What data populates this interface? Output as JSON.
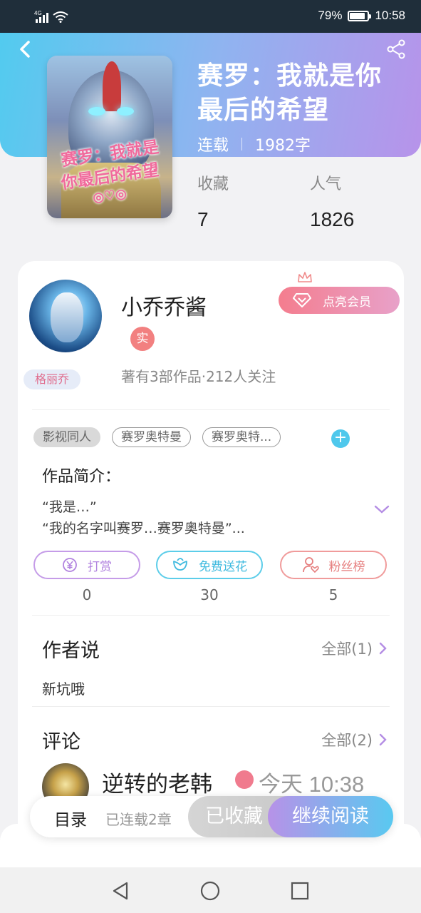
{
  "status_bar": {
    "network": "4G",
    "battery_percent_text": "79%",
    "battery_level": 0.79,
    "time": "10:58"
  },
  "header": {
    "back_icon": "chevron-left-icon",
    "share_icon": "share-icon",
    "cover_text_line1": "赛罗：我就是",
    "cover_text_line2": "你最后的希望",
    "cover_text_line3": "◎♡◎",
    "title": "赛罗：我就是你最后的希望",
    "status": "连载",
    "word_count": "1982字"
  },
  "stats": {
    "favorites_label": "收藏",
    "favorites_value": "7",
    "popularity_label": "人气",
    "popularity_value": "1826"
  },
  "author": {
    "name": "小乔乔酱",
    "verified_badge": "实",
    "fan_badge": "格丽乔",
    "summary": "著有3部作品·212人关注",
    "vip_button": "点亮会员"
  },
  "tags": [
    "影视同人",
    "赛罗奥特曼",
    "赛罗奥特..."
  ],
  "intro": {
    "label": "作品简介：",
    "line1": "“我是…”",
    "line2": "“我的名字叫赛罗…赛罗奥特曼”..."
  },
  "actions": [
    {
      "label": "打赏",
      "count": "0"
    },
    {
      "label": "免费送花",
      "count": "30"
    },
    {
      "label": "粉丝榜",
      "count": "5"
    }
  ],
  "author_says": {
    "title": "作者说",
    "more": "全部(1)",
    "content": "新坑哦"
  },
  "comments": {
    "title": "评论",
    "more": "全部(2)",
    "first": {
      "name": "逆转的老韩",
      "time": "今天 10:38"
    }
  },
  "bottom_bar": {
    "toc": "目录",
    "chapters": "已连载2章",
    "saved": "已收藏",
    "read": "继续阅读"
  },
  "colors": {
    "header_start": "#52cbef",
    "header_end": "#b793ea",
    "accent_pink": "#f47d8e",
    "accent_cyan": "#4fc8ec",
    "accent_purple": "#b792e8"
  }
}
